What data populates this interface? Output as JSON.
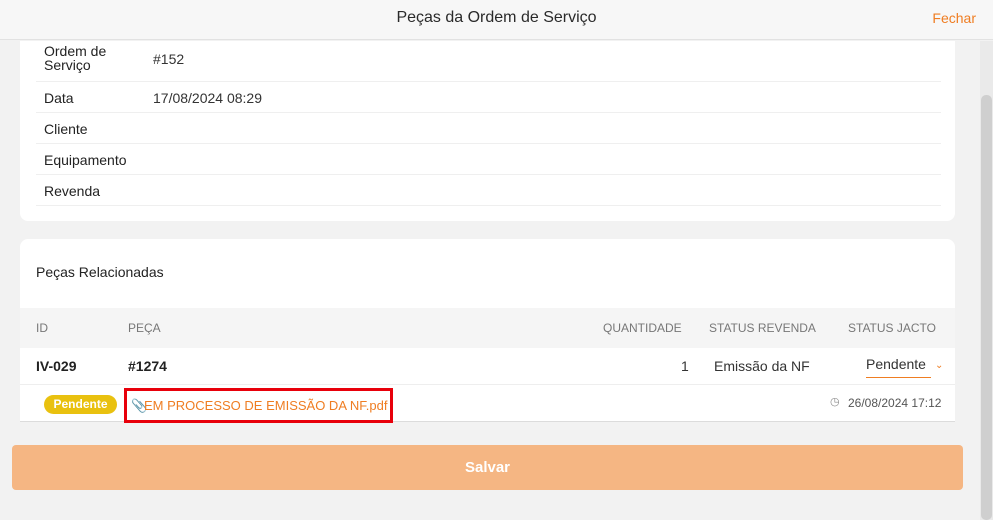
{
  "header": {
    "title": "Peças da Ordem de Serviço",
    "close_label": "Fechar"
  },
  "info": [
    {
      "label": "Ordem de Serviço",
      "value": "#152"
    },
    {
      "label": "Data",
      "value": "17/08/2024 08:29"
    },
    {
      "label": "Cliente",
      "value": ""
    },
    {
      "label": "Equipamento",
      "value": ""
    },
    {
      "label": "Revenda",
      "value": ""
    }
  ],
  "parts": {
    "heading": "Peças Relacionadas",
    "columns": [
      "ID",
      "PEÇA",
      "QUANTIDADE",
      "STATUS REVENDA",
      "STATUS JACTO"
    ],
    "rows": [
      {
        "id": "IV-029",
        "part": "#1274",
        "quantity": "1",
        "status_revenda": "Emissão da NF",
        "status_jacto": "Pendente",
        "badge": "Pendente",
        "attachment": "EM PROCESSO DE EMISSÃO DA NF.pdf",
        "attachment_date": "26/08/2024 17:12"
      }
    ]
  },
  "footer": {
    "save_label": "Salvar"
  },
  "colors": {
    "accent": "#ef7d22",
    "badge": "#e9c10f",
    "save_disabled": "#f5b683",
    "highlight_box": "#e8000b"
  },
  "icons": {
    "attachment": "paperclip-icon",
    "clock": "clock-icon",
    "dropdown": "chevron-down-icon"
  }
}
